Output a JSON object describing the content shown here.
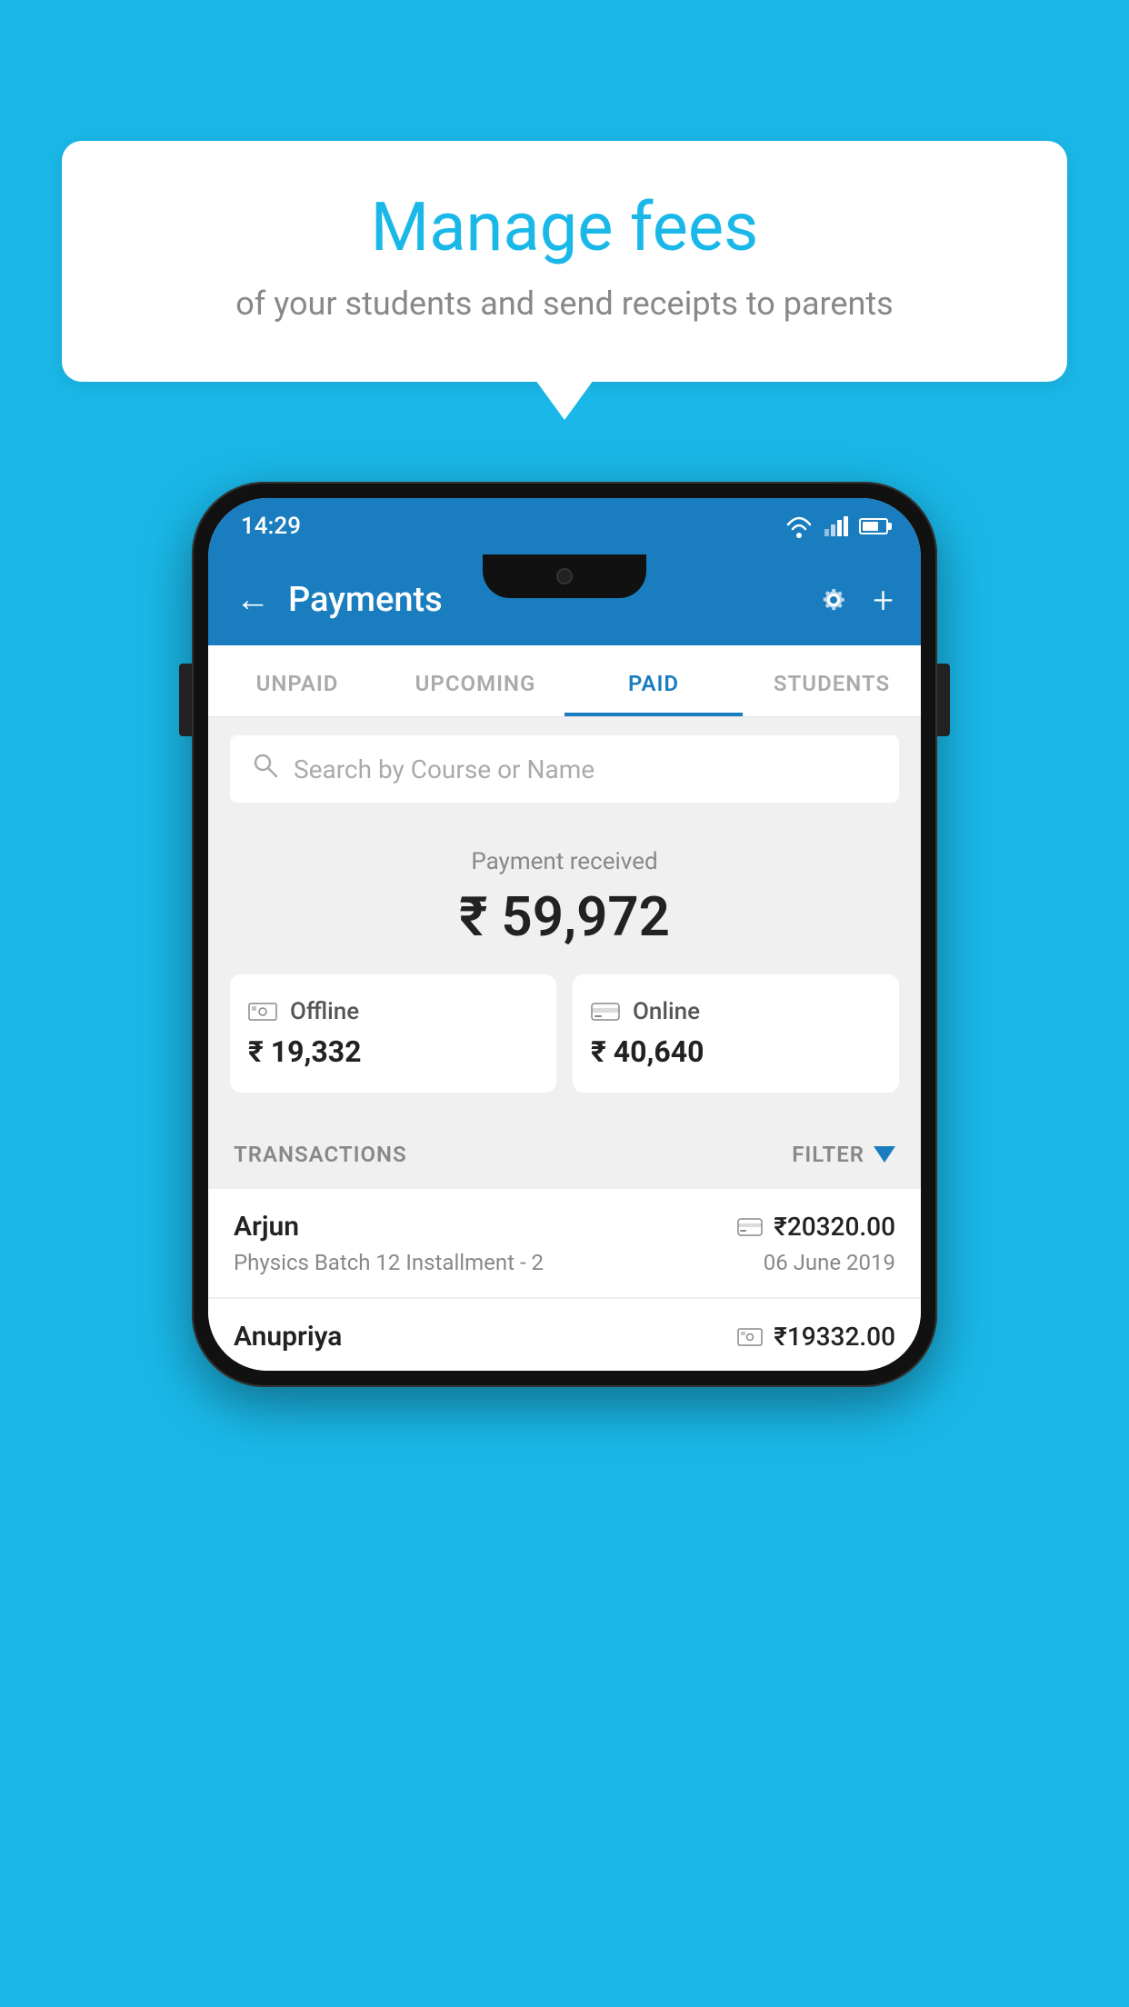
{
  "background_color": "#1ab8e8",
  "bubble": {
    "title": "Manage fees",
    "subtitle": "of your students and send receipts to parents"
  },
  "status_bar": {
    "time": "14:29"
  },
  "header": {
    "title": "Payments",
    "back_label": "←"
  },
  "tabs": [
    {
      "label": "UNPAID",
      "active": false
    },
    {
      "label": "UPCOMING",
      "active": false
    },
    {
      "label": "PAID",
      "active": true
    },
    {
      "label": "STUDENTS",
      "active": false
    }
  ],
  "search": {
    "placeholder": "Search by Course or Name"
  },
  "payment_summary": {
    "label": "Payment received",
    "total": "₹ 59,972",
    "offline_label": "Offline",
    "offline_amount": "₹ 19,332",
    "online_label": "Online",
    "online_amount": "₹ 40,640"
  },
  "transactions": {
    "label": "TRANSACTIONS",
    "filter_label": "FILTER",
    "items": [
      {
        "name": "Arjun",
        "course": "Physics Batch 12 Installment - 2",
        "date": "06 June 2019",
        "amount": "₹20320.00",
        "payment_type": "online"
      },
      {
        "name": "Anupriya",
        "course": "",
        "date": "",
        "amount": "₹19332.00",
        "payment_type": "offline"
      }
    ]
  }
}
